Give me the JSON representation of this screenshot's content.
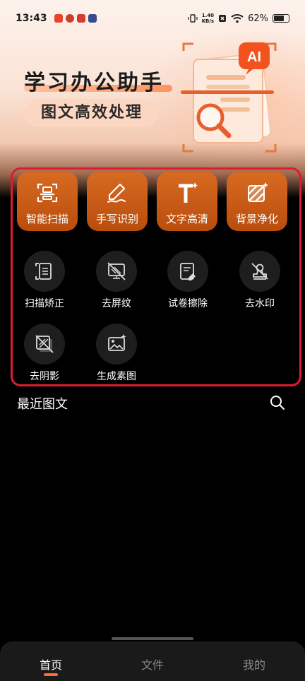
{
  "status_bar": {
    "time": "13:43",
    "net_speed_value": "1.40",
    "net_speed_unit": "KB/s",
    "battery": "62%"
  },
  "banner": {
    "title": "学习办公助手",
    "subtitle": "图文高效处理",
    "badge": "AI"
  },
  "primary_tools": [
    {
      "label": "智能扫描",
      "icon": "scan-icon"
    },
    {
      "label": "手写识别",
      "icon": "pen-icon"
    },
    {
      "label": "文字高清",
      "icon": "text-enhance-icon"
    },
    {
      "label": "背景净化",
      "icon": "background-clean-icon"
    }
  ],
  "secondary_tools": [
    {
      "label": "扫描矫正",
      "icon": "scan-correct-icon"
    },
    {
      "label": "去屏纹",
      "icon": "remove-moire-icon"
    },
    {
      "label": "试卷擦除",
      "icon": "erase-paper-icon"
    },
    {
      "label": "去水印",
      "icon": "remove-watermark-icon"
    },
    {
      "label": "去阴影",
      "icon": "remove-shadow-icon"
    },
    {
      "label": "生成素图",
      "icon": "generate-image-icon"
    }
  ],
  "recent": {
    "title": "最近图文"
  },
  "tabs": [
    {
      "label": "首页",
      "active": true
    },
    {
      "label": "文件",
      "active": false
    },
    {
      "label": "我的",
      "active": false
    }
  ],
  "colors": {
    "accent": "#e4662a",
    "highlight_border": "#e01c2c",
    "tab_indicator": "#ff6a3a"
  }
}
